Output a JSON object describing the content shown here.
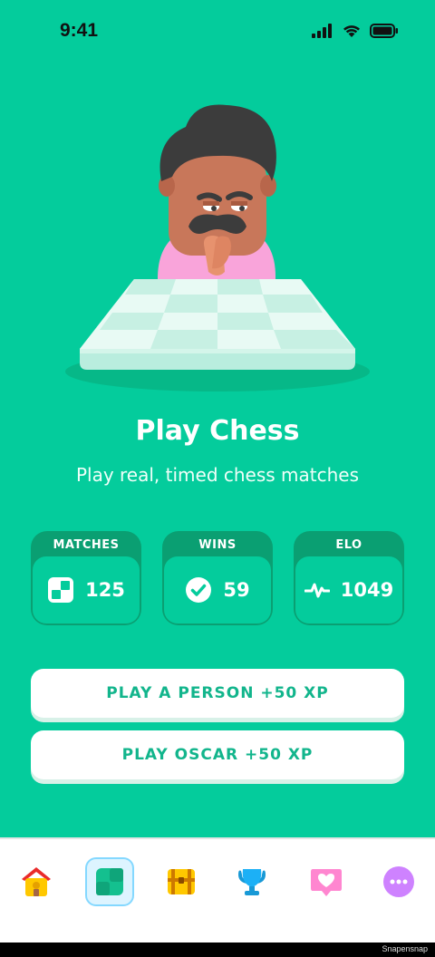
{
  "status": {
    "time": "9:41"
  },
  "hero": {
    "title": "Play Chess",
    "subtitle": "Play real, timed chess matches"
  },
  "stats": [
    {
      "label": "MATCHES",
      "value": "125",
      "icon": "chessboard-icon"
    },
    {
      "label": "WINS",
      "value": "59",
      "icon": "check-circle-icon"
    },
    {
      "label": "ELO",
      "value": "1049",
      "icon": "pulse-icon"
    }
  ],
  "buttons": {
    "play_person": "PLAY A PERSON +50 XP",
    "play_oscar": "PLAY OSCAR +50 XP"
  },
  "tabs": [
    {
      "name": "home",
      "icon": "home-icon",
      "active": false
    },
    {
      "name": "chess",
      "icon": "chess-board-icon",
      "active": true
    },
    {
      "name": "quests",
      "icon": "treasure-chest-icon",
      "active": false
    },
    {
      "name": "leagues",
      "icon": "trophy-icon",
      "active": false
    },
    {
      "name": "friends",
      "icon": "heart-message-icon",
      "active": false
    },
    {
      "name": "more",
      "icon": "more-icon",
      "active": false
    }
  ],
  "colors": {
    "background": "#04CC9C",
    "accent_text": "#12B58C",
    "card_dark": "#0A9F72",
    "tab_active_bg": "#DDF4FF",
    "tab_active_border": "#84D8FF"
  },
  "footer": {
    "label": "Snapensnap"
  }
}
